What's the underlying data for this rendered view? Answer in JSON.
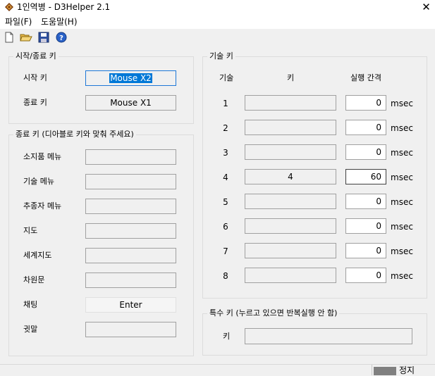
{
  "window": {
    "title": "1인역병 - D3Helper 2.1",
    "close_glyph": "✕"
  },
  "menu": [
    "파일(F)",
    "도움말(H)"
  ],
  "toolbar": [
    "new-file-icon",
    "open-folder-icon",
    "save-icon",
    "help-icon"
  ],
  "start_stop": {
    "title": "시작/종료 키",
    "start_label": "시작 키",
    "start_value": "Mouse X2",
    "stop_label": "종료 키",
    "stop_value": "Mouse X1"
  },
  "game_keys": {
    "title": "종료 키 (디아블로 키와 맞춰 주세요)",
    "rows": [
      {
        "label": "소지품 메뉴",
        "value": ""
      },
      {
        "label": "기술 메뉴",
        "value": ""
      },
      {
        "label": "추종자 메뉴",
        "value": ""
      },
      {
        "label": "지도",
        "value": ""
      },
      {
        "label": "세계지도",
        "value": ""
      },
      {
        "label": "차원문",
        "value": ""
      },
      {
        "label": "채팅",
        "value": "Enter"
      },
      {
        "label": "귓말",
        "value": ""
      }
    ]
  },
  "skills": {
    "title": "기술 키",
    "col_skill": "기술",
    "col_key": "키",
    "col_interval": "실행 간격",
    "unit": "msec",
    "rows": [
      {
        "num": "1",
        "key": "",
        "interval": "0"
      },
      {
        "num": "2",
        "key": "",
        "interval": "0"
      },
      {
        "num": "3",
        "key": "",
        "interval": "0"
      },
      {
        "num": "4",
        "key": "4",
        "interval": "60"
      },
      {
        "num": "5",
        "key": "",
        "interval": "0"
      },
      {
        "num": "6",
        "key": "",
        "interval": "0"
      },
      {
        "num": "7",
        "key": "",
        "interval": "0"
      },
      {
        "num": "8",
        "key": "",
        "interval": "0"
      }
    ]
  },
  "special": {
    "title": "특수 키 (누르고 있으면 반복실행 안 함)",
    "key_label": "키",
    "key_value": ""
  },
  "status": {
    "text": "정지",
    "indicator_color": "#808080"
  }
}
